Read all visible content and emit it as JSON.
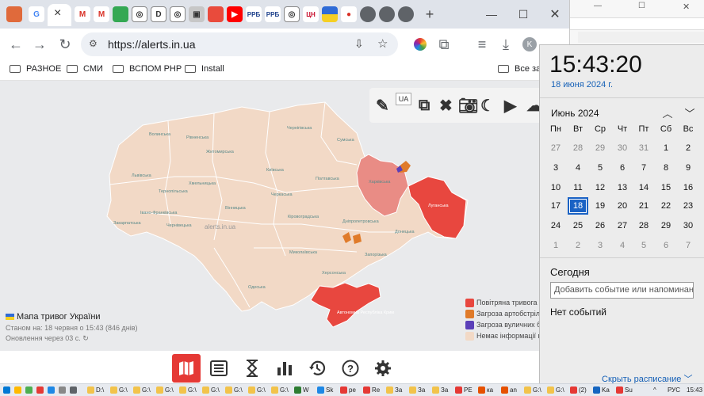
{
  "browser": {
    "url": "https://alerts.in.ua",
    "bookmarks": [
      "РАЗНОЕ",
      "СМИ",
      "ВСПОМ PHP",
      "Install",
      "Все зак"
    ]
  },
  "map": {
    "watermark": "alerts.in.ua",
    "tools_badge": "UA",
    "regions": {
      "volyn": "Волинська",
      "rivne": "Рівненська",
      "chernihiv": "Чернігівська",
      "sumy": "Сумська",
      "zhytomyr": "Житомирська",
      "kyiv": "Київська",
      "lviv": "Львівська",
      "ternopil": "Тернопільська",
      "khmelnytskyi": "Хмельницька",
      "poltava": "Полтавська",
      "kharkiv": "Харківська",
      "cherkasy": "Черкаська",
      "vinnytsia": "Вінницька",
      "luhansk": "Луганська",
      "ivano_frankivsk": "Івано-Франківська",
      "zakarpattia": "Закарпатська",
      "chernivtsi": "Чернівецька",
      "kirovohrad": "Кіровоградська",
      "dnipropetrovsk": "Дніпропетровська",
      "donetsk": "Донецька",
      "zaporizhzhia": "Запорізька",
      "mykolaiv": "Миколаївська",
      "kherson": "Херсонська",
      "odesa": "Одеська",
      "crimea": "Автономна Республіка Крим"
    },
    "legend": [
      {
        "label": "Повітряна тривога",
        "color": "#e8473f"
      },
      {
        "label": "Загроза артобстрілу",
        "color": "#e07b2a"
      },
      {
        "label": "Загроза вуличних боїв",
        "color": "#5b3fb8"
      },
      {
        "label": "Немає інформації про",
        "color": "#f2d9c6"
      }
    ],
    "title": "Мапа тривог України",
    "status_line": "Станом на: 18 червня о 15:43 (846 днів)",
    "update_line": "Оновлення через 03 с."
  },
  "bottom_nav": [
    "map",
    "list",
    "hourglass",
    "stats",
    "history",
    "help",
    "settings"
  ],
  "calendar": {
    "time": "15:43:20",
    "date": "18 июня 2024 г.",
    "month": "Июнь 2024",
    "weekdays": [
      "Пн",
      "Вт",
      "Ср",
      "Чт",
      "Пт",
      "Сб",
      "Вс"
    ],
    "weeks": [
      [
        "27",
        "28",
        "29",
        "30",
        "31",
        "1",
        "2"
      ],
      [
        "3",
        "4",
        "5",
        "6",
        "7",
        "8",
        "9"
      ],
      [
        "10",
        "11",
        "12",
        "13",
        "14",
        "15",
        "16"
      ],
      [
        "17",
        "18",
        "19",
        "20",
        "21",
        "22",
        "23"
      ],
      [
        "24",
        "25",
        "26",
        "27",
        "28",
        "29",
        "30"
      ],
      [
        "1",
        "2",
        "3",
        "4",
        "5",
        "6",
        "7"
      ]
    ],
    "today": "18",
    "today_label": "Сегодня",
    "event_placeholder": "Добавить событие или напоминание",
    "no_events": "Нет событий",
    "schedule_link": "Скрыть расписание"
  },
  "taskbar": {
    "items": [
      "D:\\",
      "G:\\",
      "G:\\",
      "G:\\",
      "G:\\",
      "G:\\",
      "G:\\",
      "G:\\",
      "G:\\",
      "W",
      "Sk",
      "ре",
      "Re",
      "За",
      "За",
      "За",
      "PE",
      "ка",
      "an",
      "G:\\",
      "G:\\",
      "(2)",
      "Ka",
      "Su"
    ],
    "lang": "РУС",
    "clock": "15:43"
  }
}
